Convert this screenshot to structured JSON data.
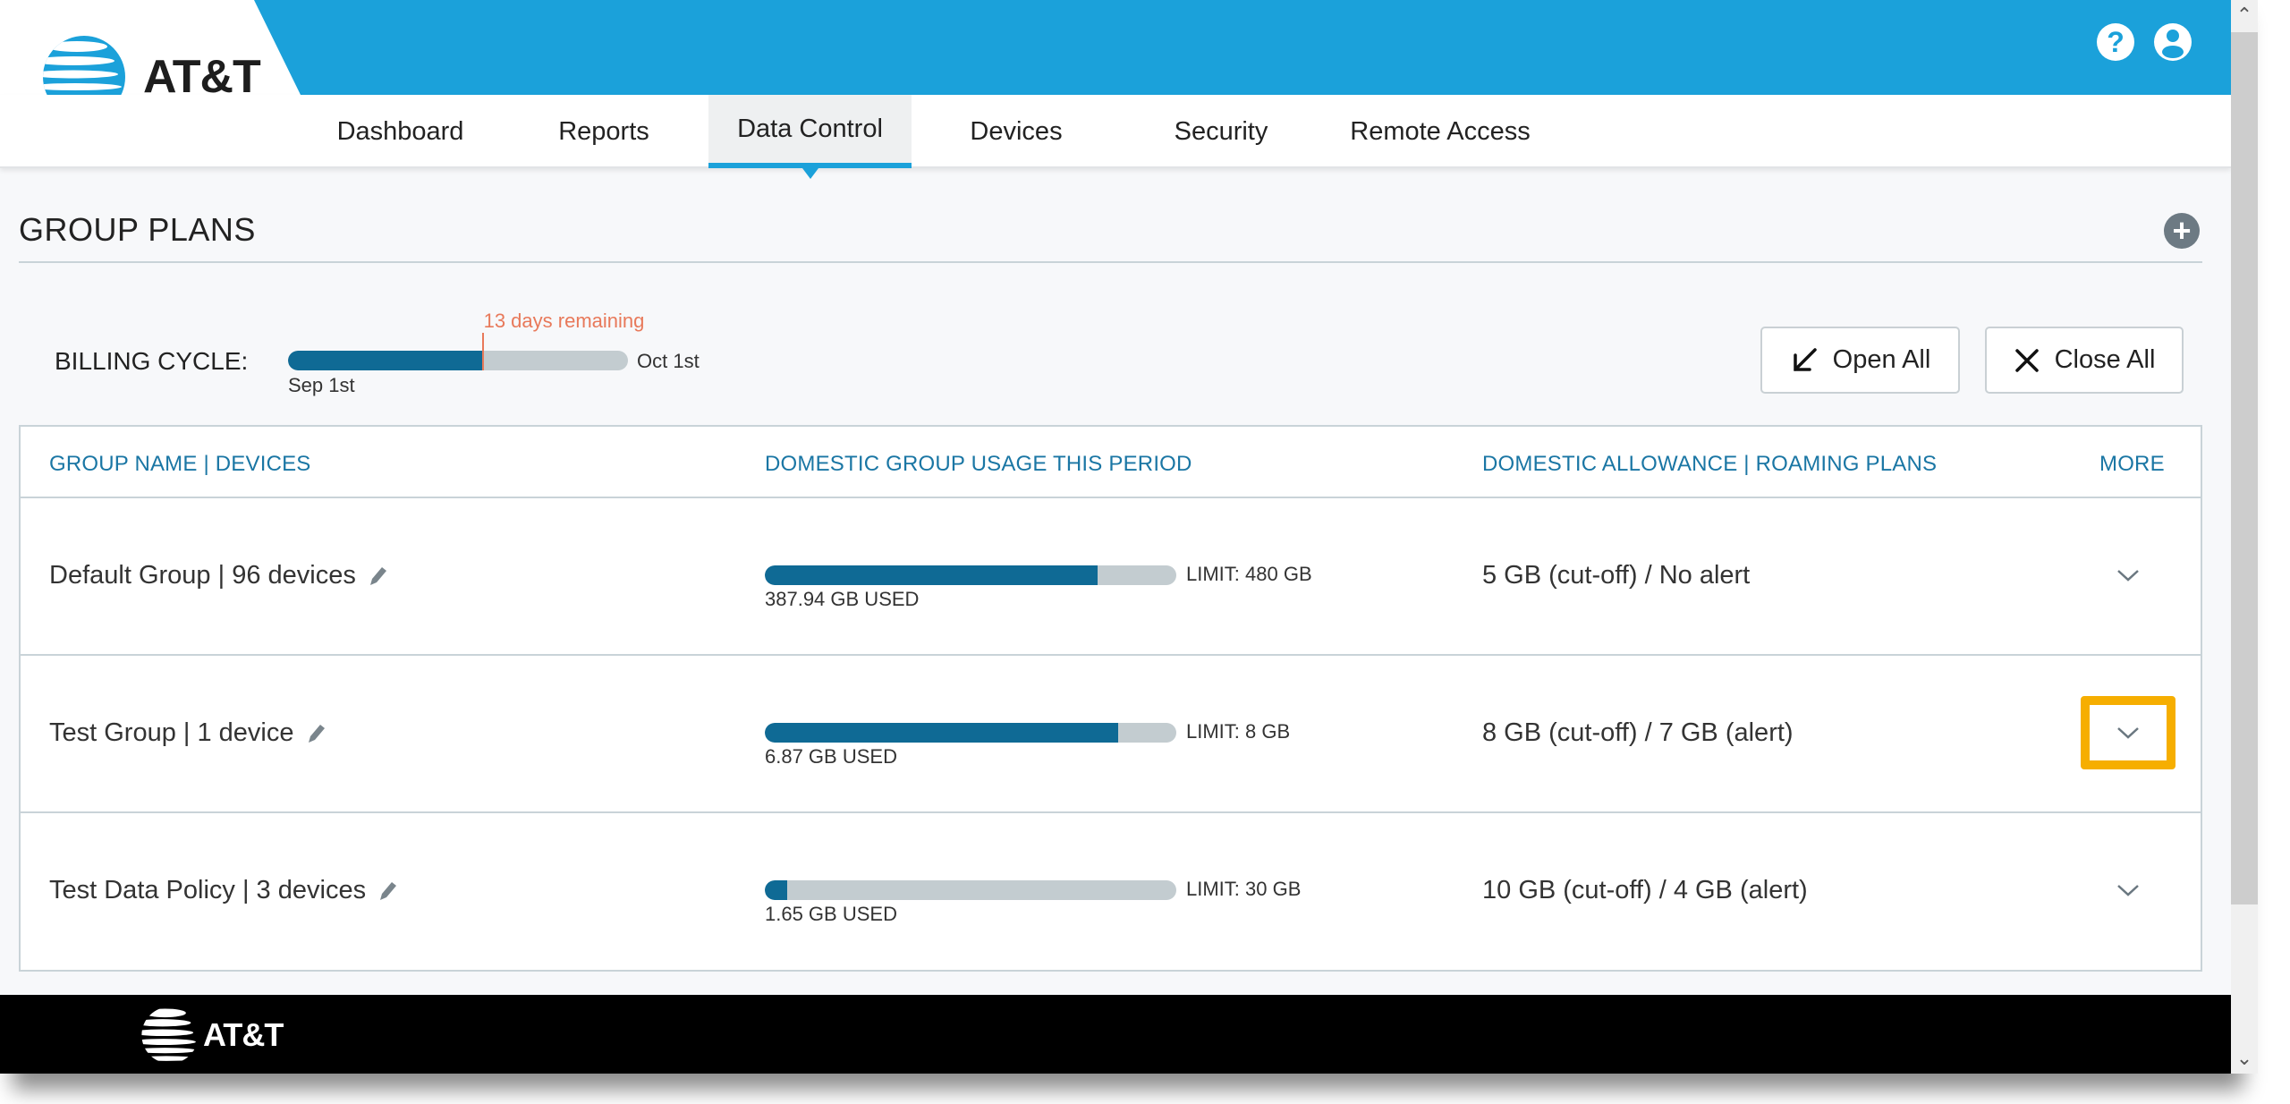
{
  "brand": {
    "name": "AT&T",
    "primary_color": "#1ba1da",
    "accent_dark": "#0f6a95",
    "highlight_color": "#f6ae00"
  },
  "header": {
    "icons": [
      {
        "name": "help-icon",
        "glyph": "?"
      },
      {
        "name": "user-account-icon",
        "glyph": "person"
      }
    ]
  },
  "nav": {
    "items": [
      {
        "label": "Dashboard",
        "active": false
      },
      {
        "label": "Reports",
        "active": false
      },
      {
        "label": "Data Control",
        "active": true
      },
      {
        "label": "Devices",
        "active": false
      },
      {
        "label": "Security",
        "active": false
      },
      {
        "label": "Remote Access",
        "active": false
      }
    ]
  },
  "section": {
    "title": "GROUP PLANS",
    "add_icon": "plus-circle-icon"
  },
  "billing": {
    "label": "BILLING CYCLE:",
    "start": "Sep 1st",
    "end": "Oct 1st",
    "remaining": "13 days remaining",
    "elapsed_fraction": 0.57
  },
  "buttons": {
    "open_all": "Open All",
    "close_all": "Close All"
  },
  "table": {
    "headers": [
      "GROUP NAME | DEVICES",
      "DOMESTIC GROUP USAGE THIS PERIOD",
      "DOMESTIC ALLOWANCE | ROAMING PLANS",
      "MORE"
    ],
    "rows": [
      {
        "name": "Default Group | 96 devices",
        "used": "387.94 GB USED",
        "limit": "LIMIT: 480 GB",
        "used_fraction": 0.808,
        "allowance": "5 GB (cut-off) / No alert",
        "highlighted": false
      },
      {
        "name": "Test Group | 1 device",
        "used": "6.87 GB USED",
        "limit": "LIMIT: 8 GB",
        "used_fraction": 0.859,
        "allowance": "8 GB (cut-off) / 7 GB (alert)",
        "highlighted": true
      },
      {
        "name": "Test Data Policy | 3 devices",
        "used": "1.65 GB USED",
        "limit": "LIMIT: 30 GB",
        "used_fraction": 0.055,
        "allowance": "10 GB (cut-off) / 4 GB (alert)",
        "highlighted": false
      }
    ]
  },
  "footer": {
    "logo_text": "AT&T"
  }
}
